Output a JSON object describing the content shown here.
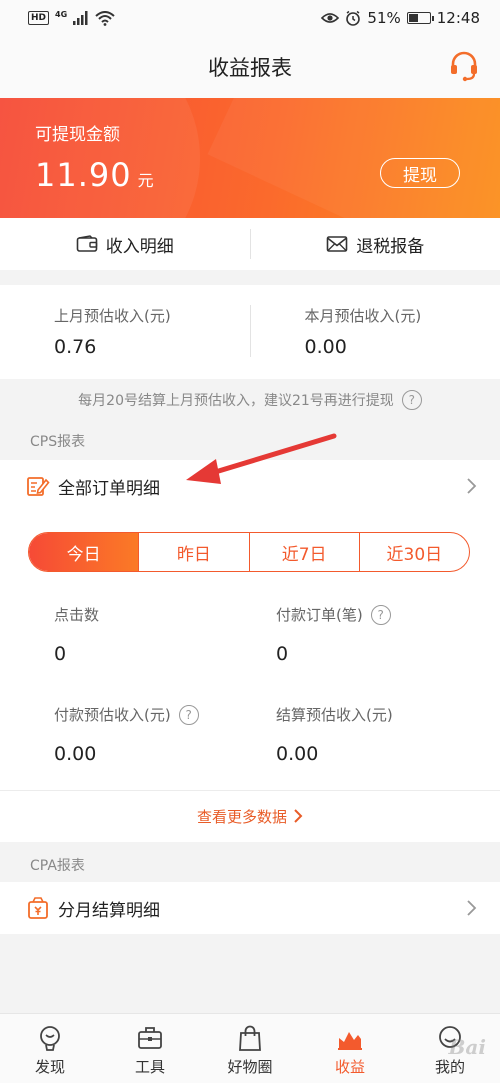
{
  "status_bar": {
    "left_badges": [
      "HD",
      "4G"
    ],
    "battery": "51%",
    "time": "12:48",
    "battery_level": 0.51
  },
  "header": {
    "title": "收益报表",
    "support_icon": "headset-icon"
  },
  "hero": {
    "label": "可提现金额",
    "amount": "11.90",
    "unit": "元",
    "withdraw_label": "提现"
  },
  "quick_tabs": [
    {
      "label": "收入明细",
      "icon": "wallet-icon"
    },
    {
      "label": "退税报备",
      "icon": "envelope-icon"
    }
  ],
  "estimates": {
    "last_month": {
      "label": "上月预估收入(元)",
      "value": "0.76"
    },
    "this_month": {
      "label": "本月预估收入(元)",
      "value": "0.00"
    }
  },
  "notice": {
    "text": "每月20号结算上月预估收入，建议21号再进行提现",
    "help": "?"
  },
  "cps": {
    "section_title": "CPS报表",
    "row_label": "全部订单明细"
  },
  "periods": {
    "options": [
      "今日",
      "昨日",
      "近7日",
      "近30日"
    ],
    "selected": "今日"
  },
  "metrics": {
    "clicks": {
      "label": "点击数",
      "value": "0"
    },
    "paid_orders": {
      "label": "付款订单(笔)",
      "value": "0",
      "help": "?"
    },
    "paid_income": {
      "label": "付款预估收入(元)",
      "value": "0.00",
      "help": "?"
    },
    "settled_income": {
      "label": "结算预估收入(元)",
      "value": "0.00"
    }
  },
  "more_label": "查看更多数据",
  "cpa": {
    "section_title": "CPA报表",
    "row_label": "分月结算明细"
  },
  "bottom_nav": [
    {
      "label": "发现",
      "icon": "discover-icon"
    },
    {
      "label": "工具",
      "icon": "toolbox-icon"
    },
    {
      "label": "好物圈",
      "icon": "shopping-bag-icon"
    },
    {
      "label": "收益",
      "icon": "earnings-chart-icon"
    },
    {
      "label": "我的",
      "icon": "profile-face-icon"
    }
  ],
  "active_tab": "收益",
  "colors": {
    "accent": "#f35a2d",
    "hero_start": "#f64a36",
    "hero_end": "#fb8f1c",
    "annotation": "#e53935"
  },
  "watermark": "Bai"
}
